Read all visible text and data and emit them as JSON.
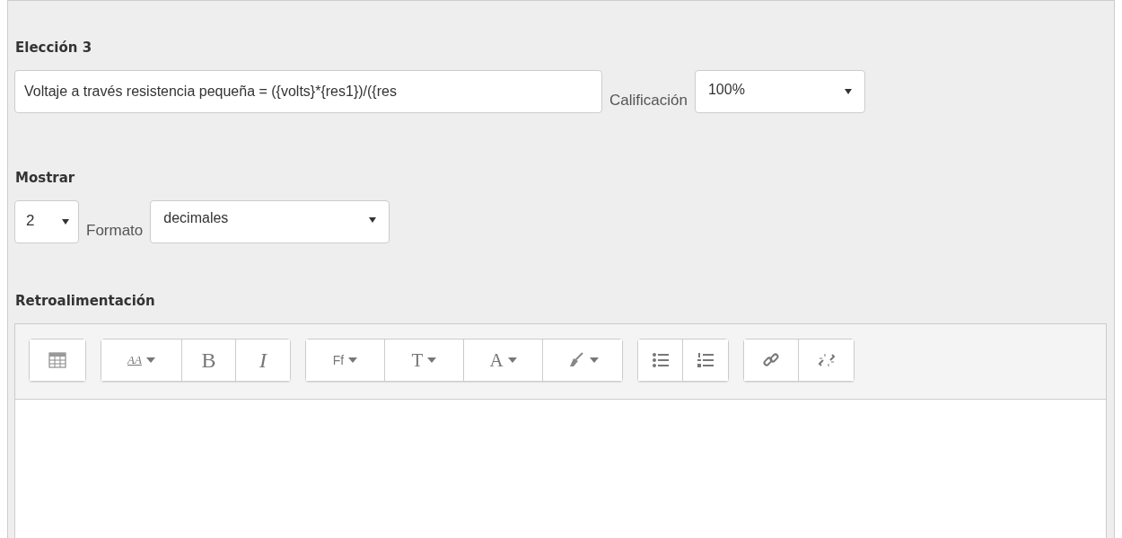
{
  "choice": {
    "heading": "Elección 3",
    "answer": {
      "value": "Voltaje a través resistencia pequeña = ({volts}*{res1})/({res"
    },
    "grade_label": "Calificación",
    "grade": {
      "value": "100%"
    }
  },
  "display": {
    "heading": "Mostrar",
    "digits": {
      "value": "2"
    },
    "format_label": "Formato",
    "format": {
      "value": "decimales"
    }
  },
  "feedback": {
    "heading": "Retroalimentación",
    "toolbar": [
      [
        {
          "kind": "table",
          "dropdown": false
        }
      ],
      [
        {
          "kind": "styles",
          "label": "AA",
          "dropdown": true
        },
        {
          "kind": "bold",
          "label": "B",
          "dropdown": false
        },
        {
          "kind": "italic",
          "label": "I",
          "dropdown": false
        }
      ],
      [
        {
          "kind": "font",
          "label": "Ff",
          "dropdown": true
        },
        {
          "kind": "size",
          "label": "T",
          "dropdown": true
        },
        {
          "kind": "color",
          "label": "A",
          "dropdown": true
        },
        {
          "kind": "highlight",
          "dropdown": true
        }
      ],
      [
        {
          "kind": "bullets",
          "dropdown": false
        },
        {
          "kind": "numbers",
          "dropdown": false
        }
      ],
      [
        {
          "kind": "link",
          "dropdown": false
        },
        {
          "kind": "unlink",
          "dropdown": false
        }
      ]
    ]
  }
}
